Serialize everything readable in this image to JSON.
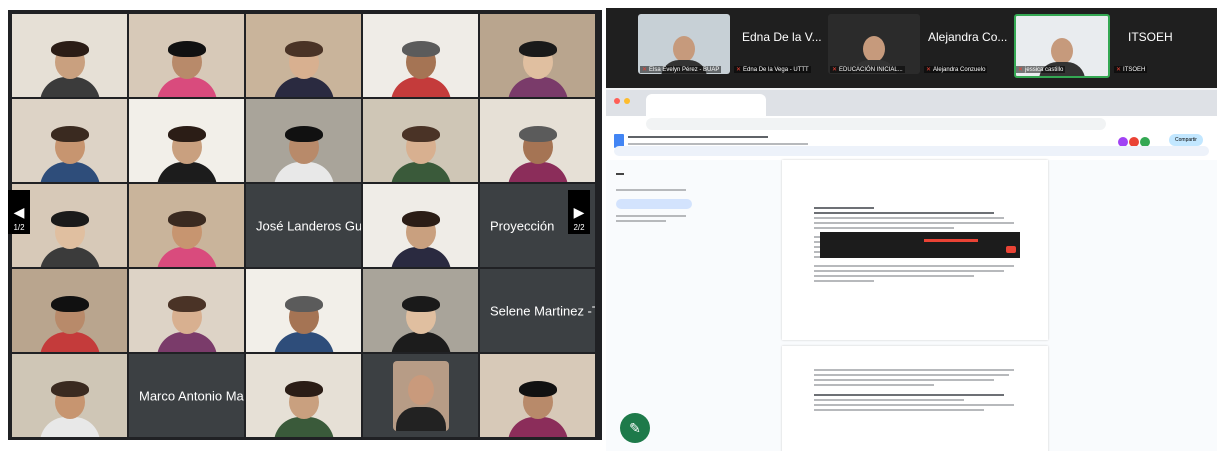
{
  "video_grid": {
    "name_tiles": [
      "José Landeros Gu...",
      "Proyección",
      "Selene Martinez -T...",
      "Marco Antonio Mar..."
    ],
    "nav": {
      "prev_page": "1/2",
      "next_page": "2/2"
    }
  },
  "meet_strip": {
    "speakers": [
      {
        "name": "",
        "label": "Elsa Evelyn Pérez - BUAP"
      },
      {
        "name": "Edna De la V...",
        "label": "Edna De la Vega - UTTT"
      },
      {
        "name": "",
        "label": "EDUCACIÓN INICIAL..."
      },
      {
        "name": "Alejandra Co...",
        "label": "Alejandra Conzuelo"
      },
      {
        "name": "",
        "label": "jessica castillo"
      },
      {
        "name": "ITSOEH",
        "label": "ITSOEH"
      }
    ]
  },
  "doc": {
    "share_label": "Compartir"
  }
}
